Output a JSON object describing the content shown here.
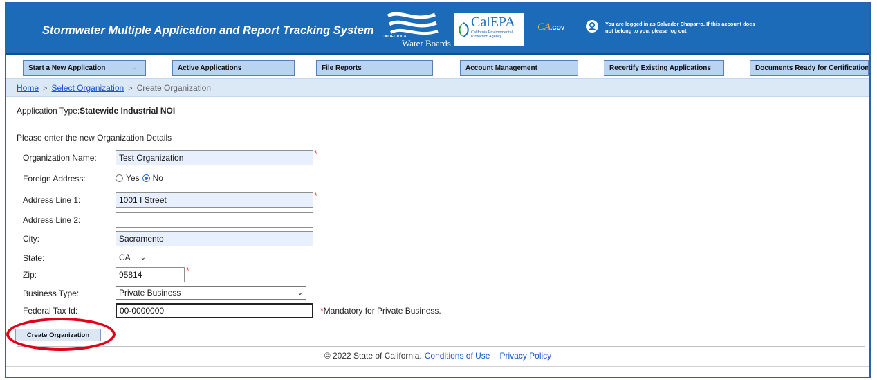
{
  "header": {
    "app_title": "Stormwater Multiple Application and Report Tracking System",
    "water_boards_small": "CALIFORNIA",
    "water_boards_text": "Water Boards",
    "calepa_name": "CalEPA",
    "calepa_sub": "California Environmental Protection Agency",
    "cagov_text": "CA",
    "cagov_suffix": ".GOV",
    "login_message": "You are logged in as Salvador Chaparro. If this account does not belong to you, please log out.",
    "colors": {
      "header_bg": "#1c6bb8",
      "gold": "#f0b52b"
    }
  },
  "nav": {
    "items": [
      {
        "label": "Start a New Application",
        "caret": "⌄"
      },
      {
        "label": "Active Applications"
      },
      {
        "label": "File Reports"
      },
      {
        "label": "Account Management"
      },
      {
        "label": "Recertify Existing Applications"
      },
      {
        "label": "Documents Ready for Certification"
      }
    ]
  },
  "breadcrumb": {
    "home": "Home",
    "sep": ">",
    "select_org": "Select Organization",
    "current": "Create Organization"
  },
  "application": {
    "type_label": "Application Type:",
    "type_value": "Statewide Industrial NOI"
  },
  "form": {
    "instruction": "Please enter the new Organization Details",
    "required_mark": "*",
    "org_name": {
      "label": "Organization Name:",
      "value": "Test Organization"
    },
    "foreign_address": {
      "label": "Foreign Address:",
      "yes": "Yes",
      "no": "No",
      "selected": "No"
    },
    "address1": {
      "label": "Address Line 1:",
      "value": "1001 I Street"
    },
    "address2": {
      "label": "Address Line 2:",
      "value": ""
    },
    "city": {
      "label": "City:",
      "value": "Sacramento"
    },
    "state": {
      "label": "State:",
      "value": "CA"
    },
    "zip": {
      "label": "Zip:",
      "value": "95814"
    },
    "business_type": {
      "label": "Business Type:",
      "value": "Private Business"
    },
    "federal_tax_id": {
      "label": "Federal Tax Id:",
      "value": "00-0000000",
      "note": "Mandatory for Private Business."
    },
    "create_button": "Create Organization"
  },
  "footer": {
    "copyright": "© 2022 State of California.",
    "conditions": "Conditions of Use",
    "privacy": "Privacy Policy"
  },
  "annotation": {
    "highlight_color": "#e0001a",
    "highlights": "create-organization-button"
  }
}
